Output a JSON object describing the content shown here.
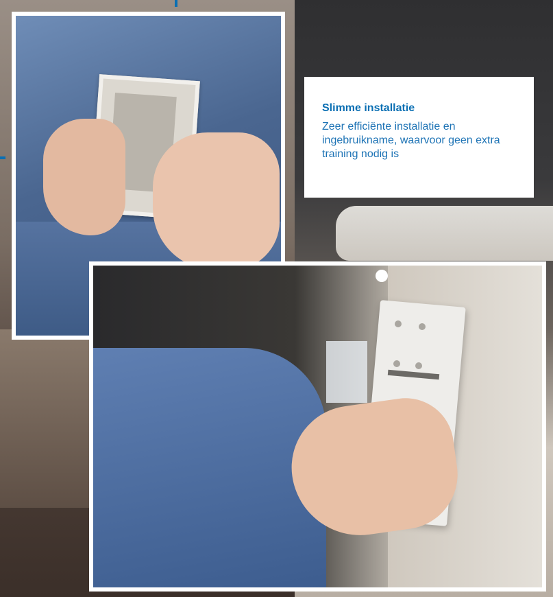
{
  "card": {
    "title": "Slimme installatie",
    "body": "Zeer efficiënte installatie en ingebruikname, waarvoor geen extra training nodig is"
  },
  "colors": {
    "accent": "#0a6fb3",
    "card_background": "#ffffff"
  }
}
